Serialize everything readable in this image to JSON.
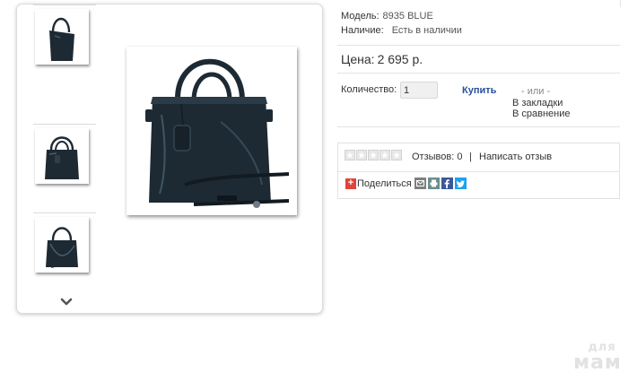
{
  "details": {
    "model_label": "Модель:",
    "model_value": "8935 BLUE",
    "availability_label": "Наличие:",
    "availability_value": "Есть в наличии",
    "price_label": "Цена:",
    "price_value": "2 695 р.",
    "quantity_label": "Количество:",
    "quantity_value": "1",
    "buy_label": "Купить",
    "or_label": "- или -",
    "bookmark_label": "В закладки",
    "compare_label": "В сравнение"
  },
  "reviews": {
    "rating_stars": 0,
    "rating_max": 5,
    "count_text": "Отзывов: 0",
    "separator": "|",
    "write_label": "Написать отзыв"
  },
  "share": {
    "plus": "+",
    "label": "Поделиться",
    "icons": [
      "mail-icon",
      "print-icon",
      "facebook-icon",
      "twitter-icon"
    ]
  },
  "gallery": {
    "thumbnails": [
      "handbag-front-icon",
      "handbag-side-icon",
      "handbag-angle-icon"
    ],
    "main_image": "handbag-main-image"
  },
  "watermark": {
    "line1": "для",
    "line2": "мам"
  },
  "colors": {
    "buy_link": "#2a4f9c",
    "bag": "#1e2a33",
    "share_plus": "#e0443a",
    "facebook": "#3b5998",
    "twitter": "#1da1f2"
  }
}
